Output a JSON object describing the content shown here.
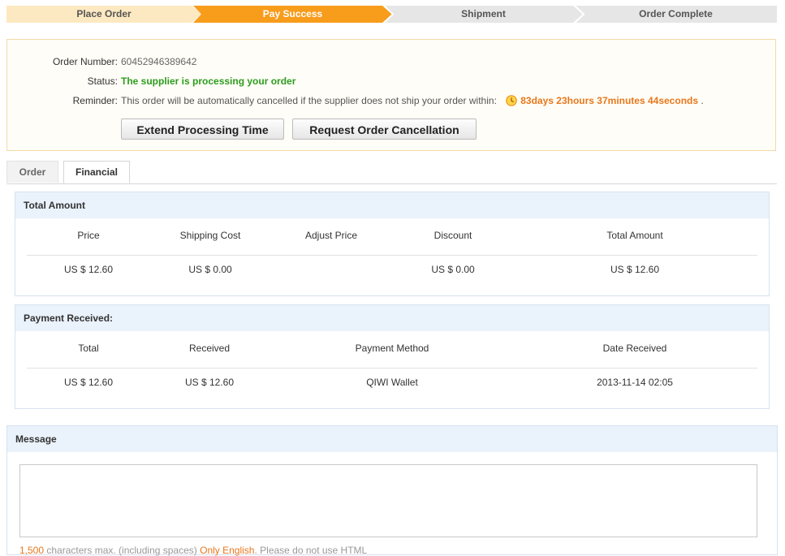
{
  "steps": [
    "Place Order",
    "Pay Success",
    "Shipment",
    "Order Complete"
  ],
  "order_info": {
    "order_number_label": "Order Number:",
    "order_number": "60452946389642",
    "status_label": "Status:",
    "status": "The supplier is processing your order",
    "reminder_label": "Reminder:",
    "reminder_text": "This order will be automatically cancelled if the supplier does not ship your order within:",
    "countdown": "83days 23hours 37minutes 44seconds",
    "countdown_suffix": ".",
    "extend_button": "Extend Processing Time",
    "cancel_button": "Request Order Cancellation"
  },
  "tabs": [
    "Order",
    "Financial"
  ],
  "total_amount": {
    "title": "Total Amount",
    "headers": [
      "Price",
      "Shipping Cost",
      "Adjust Price",
      "Discount",
      "Total Amount"
    ],
    "values": [
      "US $ 12.60",
      "US $ 0.00",
      "",
      "US $ 0.00",
      "US $ 12.60"
    ]
  },
  "payment_received": {
    "title": "Payment Received:",
    "headers": [
      "Total",
      "Received",
      "Payment Method",
      "Date Received"
    ],
    "values": [
      "US $ 12.60",
      "US $ 12.60",
      "QIWI Wallet",
      "2013-11-14 02:05"
    ]
  },
  "message": {
    "title": "Message",
    "hint_count": "1,500",
    "hint_mid": " characters max. (including spaces) ",
    "hint_lang": "Only English",
    "hint_end": ". Please do not use HTML"
  },
  "colors": {
    "step_done": "#fde9c1",
    "step_active": "#f89c1c",
    "step_todo": "#e6e6e6",
    "status_green": "#2c9c1e",
    "countdown_orange": "#e8771c",
    "panel_header": "#eaf2fb"
  },
  "icons": {
    "countdown": "clock-icon"
  }
}
